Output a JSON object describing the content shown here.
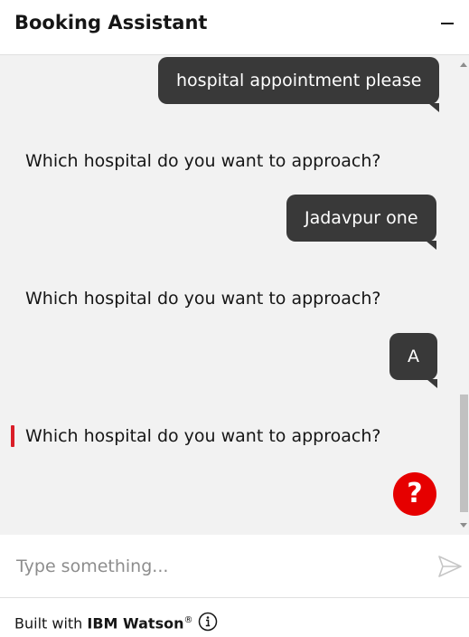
{
  "header": {
    "title": "Booking Assistant",
    "minimize_icon": "minimize-icon"
  },
  "messages": [
    {
      "sender": "user",
      "text": "hospital appointment please"
    },
    {
      "sender": "bot",
      "text": "Which hospital do you want to approach?"
    },
    {
      "sender": "user",
      "text": "Jadavpur one"
    },
    {
      "sender": "bot",
      "text": "Which hospital do you want to approach?"
    },
    {
      "sender": "user",
      "text": "A"
    },
    {
      "sender": "bot",
      "text": "Which hospital do you want to approach?"
    }
  ],
  "help_button": {
    "label": "?",
    "color": "#e60000"
  },
  "input": {
    "placeholder": "Type something...",
    "value": "",
    "send_icon": "send-icon"
  },
  "footer": {
    "built_with": "Built with",
    "brand": "IBM Watson",
    "registered": "®",
    "info_icon": "info-icon"
  },
  "colors": {
    "user_bubble": "#393939",
    "chat_background": "#f2f2f2",
    "focus_indicator": "#da1e28"
  }
}
